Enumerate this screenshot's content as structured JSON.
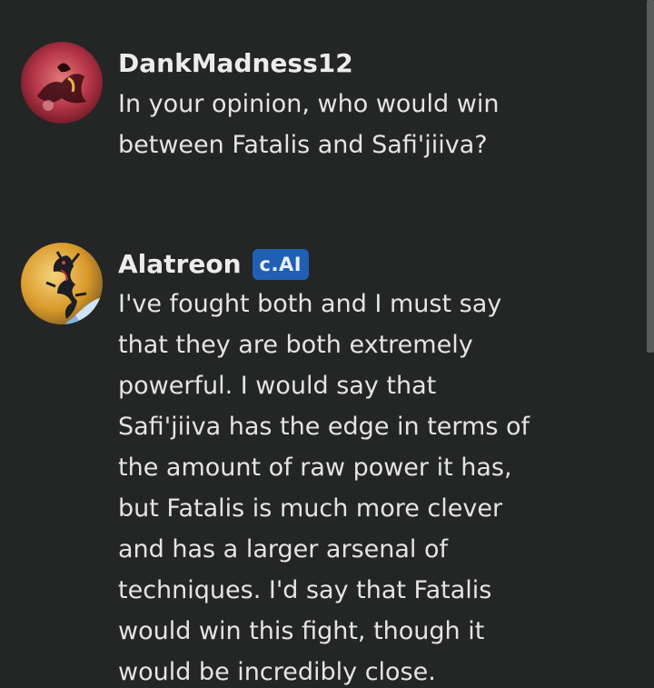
{
  "messages": [
    {
      "username": "DankMadness12",
      "badge": "",
      "text": "In your opinion, who would win\nbetween Fatalis and Safi'jiiva?",
      "avatar_icon": "red-creature-avatar"
    },
    {
      "username": "Alatreon",
      "badge": "c.AI",
      "text": "I've fought both and I must say\nthat they are both extremely\npowerful.  I would say that\nSafi'jiiva has the edge in terms of\nthe amount of raw power it has,\nbut Fatalis is much more clever\nand has a larger arsenal of\ntechniques.  I'd say that Fatalis\nwould win this fight, though it\nwould be incredibly close.",
      "avatar_icon": "dragon-avatar"
    }
  ],
  "colors": {
    "background": "#242525",
    "badge": "#1f5fb4",
    "text": "#e4e4e4"
  }
}
